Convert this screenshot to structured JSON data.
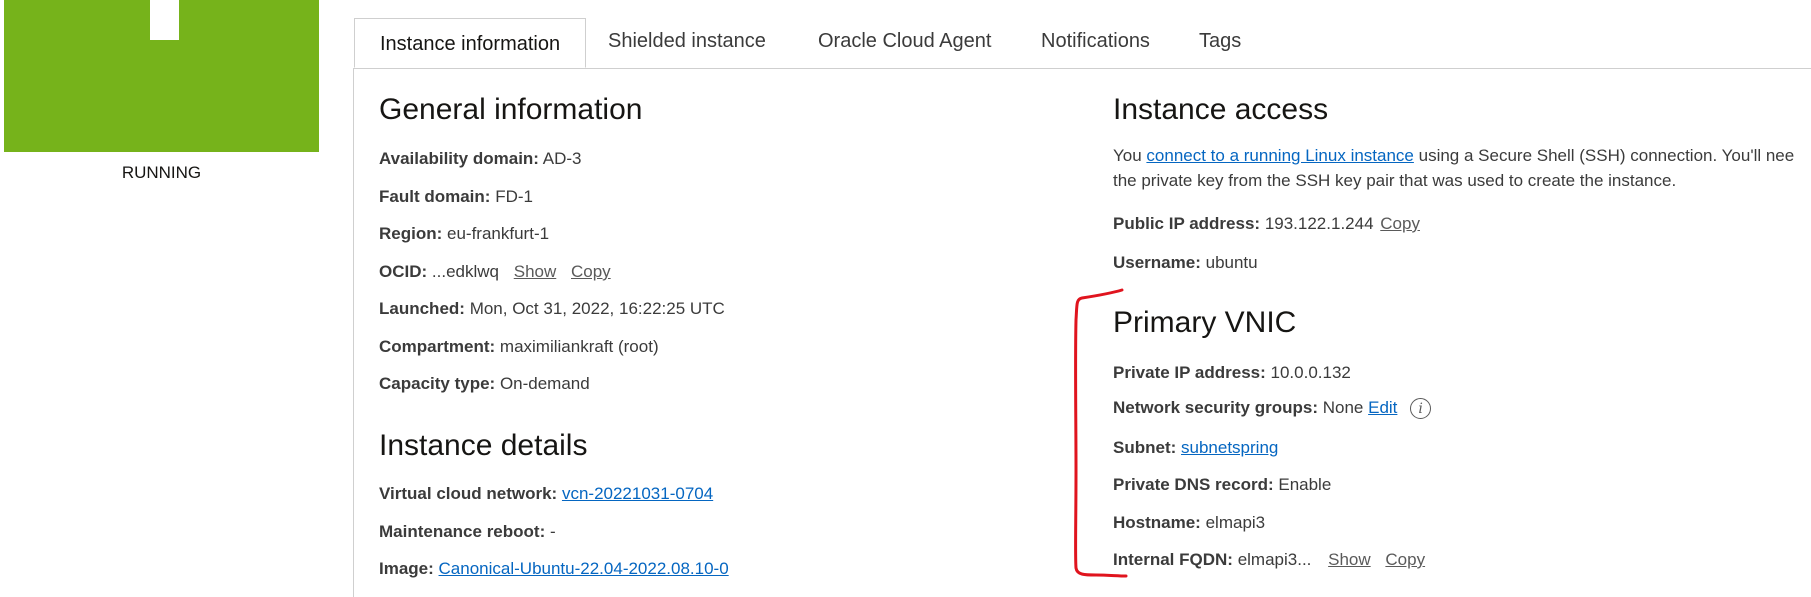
{
  "status": {
    "label": "RUNNING",
    "color": "#76b31b"
  },
  "tabs": [
    {
      "label": "Instance information",
      "active": true
    },
    {
      "label": "Shielded instance"
    },
    {
      "label": "Oracle Cloud Agent"
    },
    {
      "label": "Notifications"
    },
    {
      "label": "Tags"
    }
  ],
  "general": {
    "title": "General information",
    "availability_domain": {
      "label": "Availability domain:",
      "value": "AD-3"
    },
    "fault_domain": {
      "label": "Fault domain:",
      "value": "FD-1"
    },
    "region": {
      "label": "Region:",
      "value": "eu-frankfurt-1"
    },
    "ocid": {
      "label": "OCID:",
      "value": "...edklwq",
      "show": "Show",
      "copy": "Copy"
    },
    "launched": {
      "label": "Launched:",
      "value": "Mon, Oct 31, 2022, 16:22:25 UTC"
    },
    "compartment": {
      "label": "Compartment:",
      "value": "maximiliankraft (root)"
    },
    "capacity_type": {
      "label": "Capacity type:",
      "value": "On-demand"
    }
  },
  "details": {
    "title": "Instance details",
    "vcn": {
      "label": "Virtual cloud network:",
      "value": "vcn-20221031-0704"
    },
    "maintenance": {
      "label": "Maintenance reboot:",
      "value": "-"
    },
    "image": {
      "label": "Image:",
      "value": "Canonical-Ubuntu-22.04-2022.08.10-0"
    }
  },
  "access": {
    "title": "Instance access",
    "desc_prefix": "You ",
    "desc_link": "connect to a running Linux instance",
    "desc_suffix": " using a Secure Shell (SSH) connection. You'll nee",
    "desc_line2": "the private key from the SSH key pair that was used to create the instance.",
    "public_ip": {
      "label": "Public IP address:",
      "value": "193.122.1.244",
      "copy": "Copy"
    },
    "username": {
      "label": "Username:",
      "value": "ubuntu"
    }
  },
  "vnic": {
    "title": "Primary VNIC",
    "private_ip": {
      "label": "Private IP address:",
      "value": "10.0.0.132"
    },
    "nsg": {
      "label": "Network security groups:",
      "value": "None",
      "edit": "Edit"
    },
    "subnet": {
      "label": "Subnet:",
      "value": "subnetspring"
    },
    "dns": {
      "label": "Private DNS record:",
      "value": "Enable"
    },
    "hostname": {
      "label": "Hostname:",
      "value": "elmapi3"
    },
    "fqdn": {
      "label": "Internal FQDN:",
      "value": "elmapi3...",
      "show": "Show",
      "copy": "Copy"
    }
  },
  "colors": {
    "link": "#0566c1",
    "annotation": "#e0141e",
    "border": "#cfcfcf"
  }
}
